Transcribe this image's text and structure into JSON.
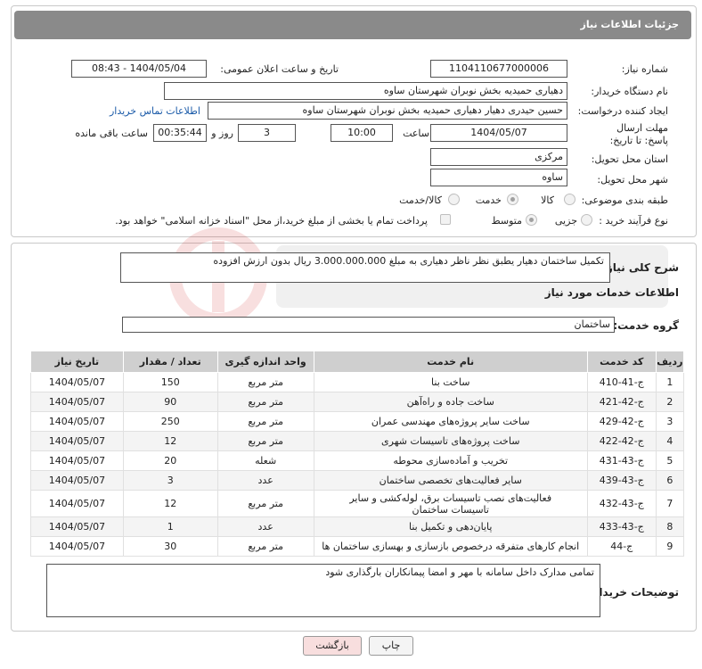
{
  "header": {
    "title": "جزئیات اطلاعات نیاز"
  },
  "form": {
    "need_number_label": "شماره نیاز:",
    "need_number": "1104110677000006",
    "announce_label": "تاریخ و ساعت اعلان عمومی:",
    "announce_value": "1404/05/04 - 08:43",
    "buyer_org_label": "نام دستگاه خریدار:",
    "buyer_org": "دهیاری حمیدیه بخش نوبران شهرستان ساوه",
    "creator_label": "ایجاد کننده درخواست:",
    "creator": "حسین حیدری دهیار دهیاری حمیدیه بخش نوبران شهرستان ساوه",
    "contact_link": "اطلاعات تماس خریدار",
    "deadline_label": "مهلت ارسال پاسخ: تا تاریخ:",
    "deadline_date": "1404/05/07",
    "time_label": "ساعت",
    "deadline_time": "10:00",
    "days_value": "3",
    "days_label": "روز و",
    "remaining_value": "00:35:44",
    "remaining_label": "ساعت باقی مانده",
    "province_label": "استان محل تحویل:",
    "province": "مرکزی",
    "city_label": "شهر محل تحویل:",
    "city": "ساوه",
    "category_label": "طبقه بندی موضوعی:",
    "category_options": [
      "کالا",
      "خدمت",
      "کالا/خدمت"
    ],
    "category_selected": "خدمت",
    "process_label": "نوع فرآیند خرید :",
    "process_options": [
      "جزیی",
      "متوسط"
    ],
    "process_selected": "متوسط",
    "payment_note": "پرداخت تمام یا بخشی از مبلغ خرید،از محل \"اسناد خزانه اسلامی\" خواهد بود."
  },
  "summary": {
    "label": "شرح کلی نیاز:",
    "text": "تکمیل ساختمان دهیار یطبق نظر ناظر دهیاری به مبلغ 3.000.000.000 ریال بدون ارزش افزوده"
  },
  "services": {
    "section_title": "اطلاعات خدمات مورد نیاز",
    "group_label": "گروه خدمت:",
    "group_value": "ساختمان",
    "columns": [
      "ردیف",
      "کد خدمت",
      "نام خدمت",
      "واحد اندازه گیری",
      "تعداد / مقدار",
      "تاریخ نیاز"
    ],
    "rows": [
      {
        "n": "1",
        "code": "ج-41-410",
        "name": "ساخت بنا",
        "unit": "متر مربع",
        "qty": "150",
        "date": "1404/05/07"
      },
      {
        "n": "2",
        "code": "ج-42-421",
        "name": "ساخت جاده و راه‌آهن",
        "unit": "متر مربع",
        "qty": "90",
        "date": "1404/05/07"
      },
      {
        "n": "3",
        "code": "ج-42-429",
        "name": "ساخت سایر پروژه‌های مهندسی عمران",
        "unit": "متر مربع",
        "qty": "250",
        "date": "1404/05/07"
      },
      {
        "n": "4",
        "code": "ج-42-422",
        "name": "ساخت پروژه‌های تاسیسات شهری",
        "unit": "متر مربع",
        "qty": "12",
        "date": "1404/05/07"
      },
      {
        "n": "5",
        "code": "ج-43-431",
        "name": "تخریب و آماده‌سازی محوطه",
        "unit": "شعله",
        "qty": "20",
        "date": "1404/05/07"
      },
      {
        "n": "6",
        "code": "ج-43-439",
        "name": "سایر فعالیت‌های تخصصی ساختمان",
        "unit": "عدد",
        "qty": "3",
        "date": "1404/05/07"
      },
      {
        "n": "7",
        "code": "ج-43-432",
        "name": "فعالیت‌های نصب تاسیسات برق، لوله‌کشی و سایر تاسیسات ساختمان",
        "unit": "متر مربع",
        "qty": "12",
        "date": "1404/05/07"
      },
      {
        "n": "8",
        "code": "ج-43-433",
        "name": "پایان‌دهی و تکمیل بنا",
        "unit": "عدد",
        "qty": "1",
        "date": "1404/05/07"
      },
      {
        "n": "9",
        "code": "ج-44",
        "name": "انجام کارهای متفرقه درخصوص بازسازی و بهسازی ساختمان ها",
        "unit": "متر مربع",
        "qty": "30",
        "date": "1404/05/07"
      }
    ]
  },
  "buyer_notes": {
    "label": "توضیحات خریدار:",
    "text": "تمامی مدارک داخل سامانه با مهر و امضا پیمانکاران بارگذاری شود"
  },
  "actions": {
    "print_label": "چاپ",
    "back_label": "بازگشت"
  },
  "colors": {
    "title_bar": "#8a8a8a",
    "back_button": "#f8dede",
    "link": "#1a5aa8"
  }
}
